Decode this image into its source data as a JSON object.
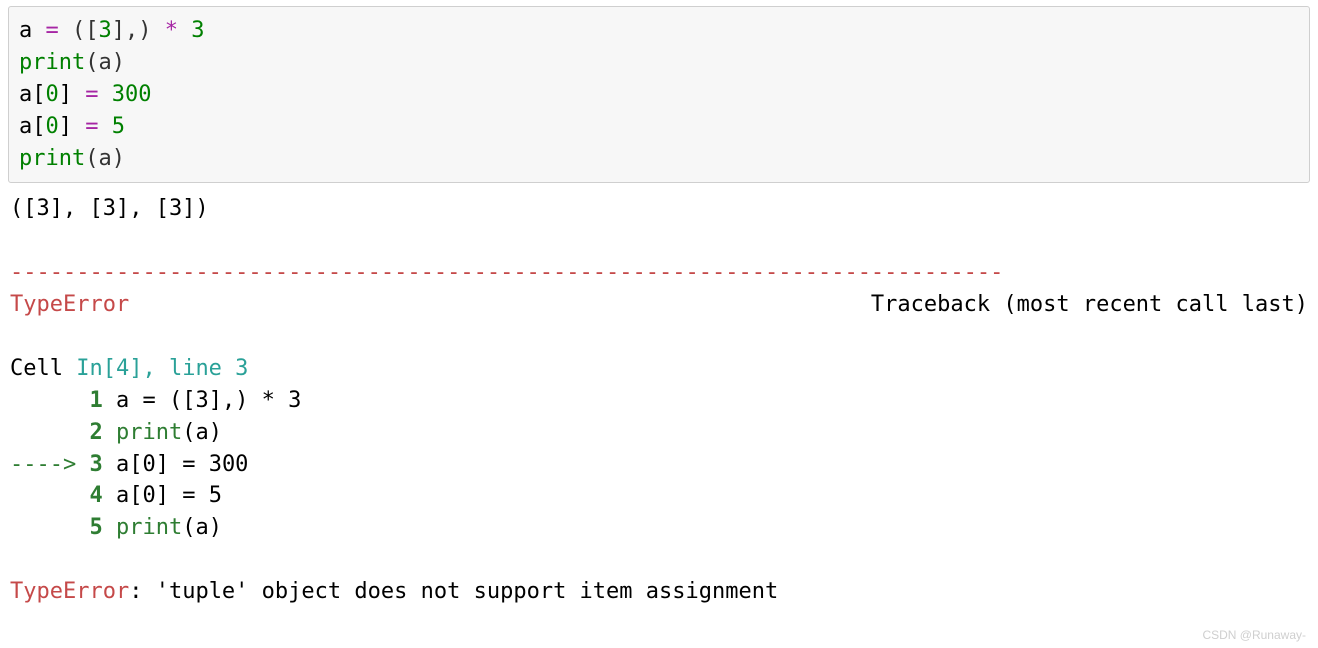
{
  "code": {
    "line1": {
      "var": "a",
      "eq": " = ",
      "lparen": "(",
      "lbrack": "[",
      "three": "3",
      "rbrack": "]",
      "comma_rparen": ",) ",
      "star": "*",
      "sp_three2": " 3"
    },
    "line2": {
      "print": "print",
      "arg": "(a)"
    },
    "line3": {
      "lhs": "a[",
      "idx": "0",
      "rhs": "] ",
      "eq": "=",
      "val_sp": " ",
      "val": "300"
    },
    "line4": {
      "lhs": "a[",
      "idx": "0",
      "rhs": "] ",
      "eq": "=",
      "val_sp": " ",
      "val": "5"
    },
    "line5": {
      "print": "print",
      "arg": "(a)"
    }
  },
  "output": {
    "line1": "([3], [3], [3])",
    "dashes": "---------------------------------------------------------------------------",
    "err_name": "TypeError",
    "traceback_label": "Traceback (most recent call last)",
    "cell_label": "Cell ",
    "in_label": "In[4], line 3",
    "tb1_num": "1",
    "tb1_rest": " a = ([3],) * 3",
    "tb2_num": "2",
    "tb2_print": " print",
    "tb2_paren": "(a)",
    "arrow": "----> ",
    "tb3_num": "3",
    "tb3_rest": " a[0] = 300",
    "tb4_num": "4",
    "tb4_rest": " a[0] = 5",
    "tb5_num": "5",
    "tb5_print": " print",
    "tb5_paren": "(a)",
    "final_err_name": "TypeError",
    "final_err_msg": ": 'tuple' object does not support item assignment"
  },
  "watermark": "CSDN @Runaway-"
}
